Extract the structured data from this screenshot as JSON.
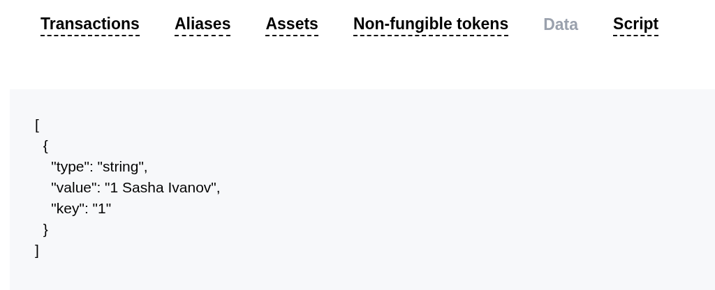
{
  "tabs": [
    {
      "label": "Transactions",
      "selected": false
    },
    {
      "label": "Aliases",
      "selected": false
    },
    {
      "label": "Assets",
      "selected": false
    },
    {
      "label": "Non-fungible tokens",
      "selected": false
    },
    {
      "label": "Data",
      "selected": true
    },
    {
      "label": "Script",
      "selected": false
    }
  ],
  "data_panel": {
    "content": "[\n  {\n    \"type\": \"string\",\n    \"value\": \"1 Sasha Ivanov\",\n    \"key\": \"1\"\n  }\n]"
  }
}
